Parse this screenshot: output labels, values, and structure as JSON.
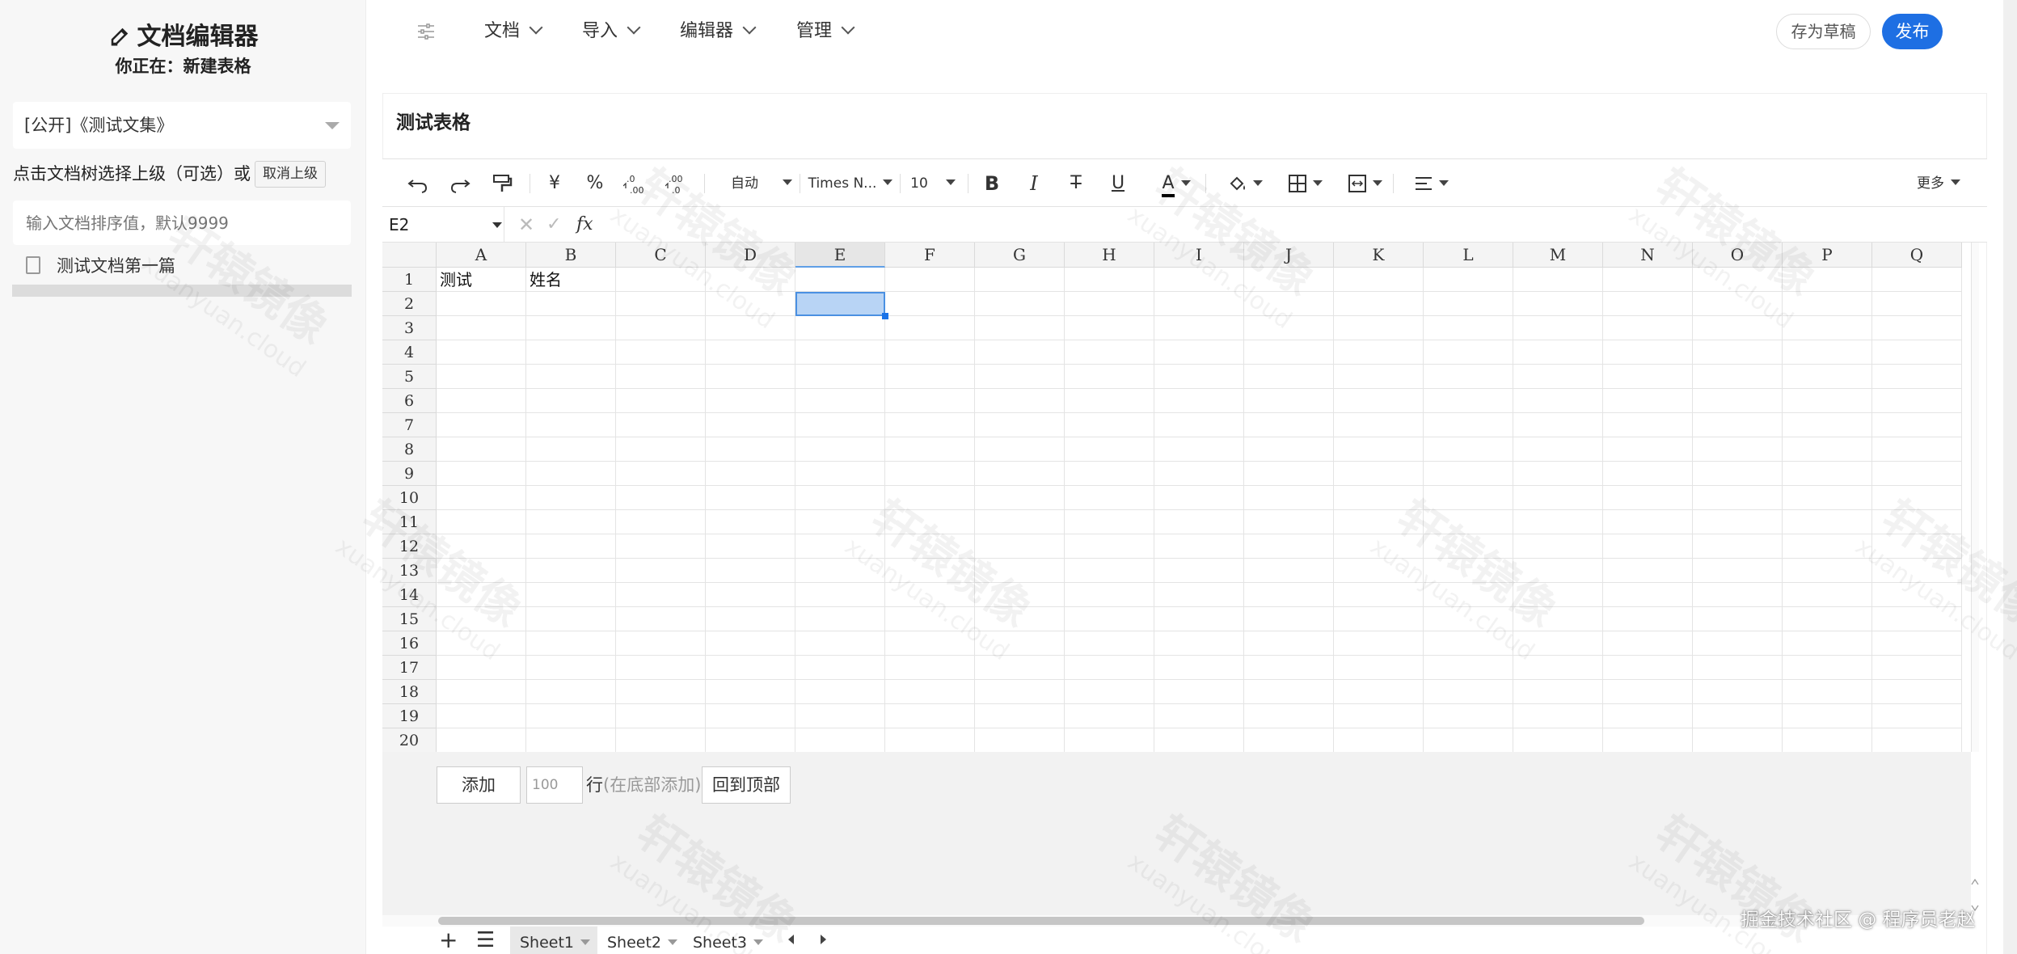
{
  "sidebar": {
    "app_title": "文档编辑器",
    "location": "你正在：新建表格",
    "collection": "[公开]《测试文集》",
    "parent_hint": "点击文档树选择上级（可选）或",
    "cancel_parent": "取消上级",
    "sort_placeholder": "输入文档排序值，默认9999",
    "tree_items": [
      "测试文档第一篇"
    ]
  },
  "nav": {
    "items": [
      "文档",
      "导入",
      "编辑器",
      "管理"
    ],
    "draft": "存为草稿",
    "publish": "发布"
  },
  "sheet": {
    "title": "测试表格",
    "toolbar": {
      "currency": "¥",
      "percent": "%",
      "format": "自动",
      "font": "Times N...",
      "size": "10",
      "more": "更多"
    },
    "cell_ref": "E2",
    "fx": "fx",
    "columns": [
      "A",
      "B",
      "C",
      "D",
      "E",
      "F",
      "G",
      "H",
      "I",
      "J",
      "K",
      "L",
      "M",
      "N",
      "O",
      "P",
      "Q"
    ],
    "rows": [
      "1",
      "2",
      "3",
      "4",
      "5",
      "6",
      "7",
      "8",
      "9",
      "10",
      "11",
      "12",
      "13",
      "14",
      "15",
      "16",
      "17",
      "18",
      "19",
      "20"
    ],
    "cells": {
      "A1": "测试",
      "B1": "姓名"
    },
    "selected": "E2"
  },
  "below": {
    "add": "添加",
    "row_count": "100",
    "row_label": "行",
    "row_hint": "(在底部添加)",
    "top": "回到顶部"
  },
  "tabs": [
    "Sheet1",
    "Sheet2",
    "Sheet3"
  ],
  "credit": "掘金技术社区 @ 程序员老赵",
  "watermark": {
    "text": "轩辕镜像",
    "sub": "xuanyuan.cloud"
  },
  "colors": {
    "accent": "#1e6fe3",
    "selection": "#b8d4f5"
  }
}
